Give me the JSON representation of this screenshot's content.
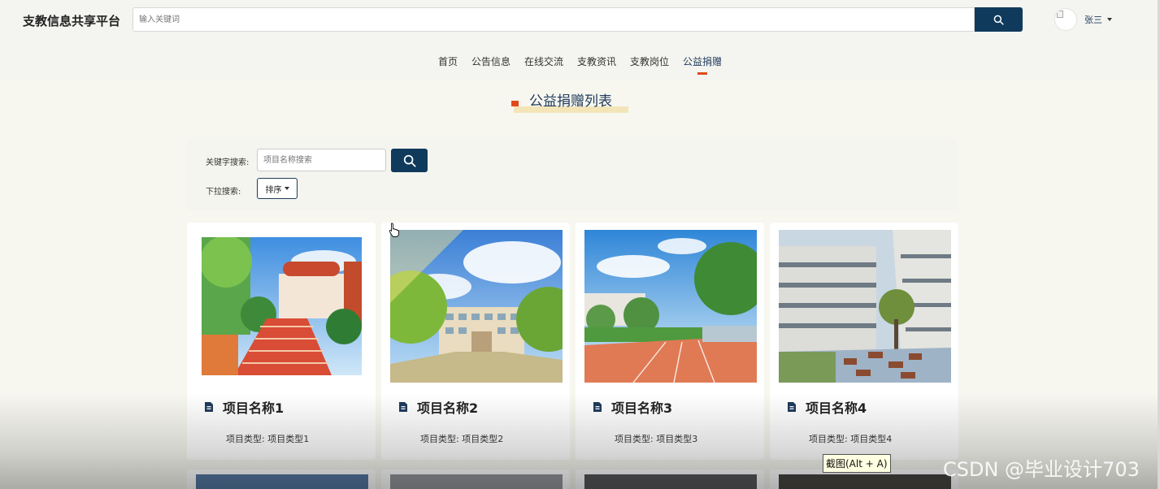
{
  "header": {
    "brand": "支教信息共享平台",
    "search_placeholder": "输入关键词",
    "username": "张三"
  },
  "nav": [
    {
      "label": "首页",
      "active": false
    },
    {
      "label": "公告信息",
      "active": false
    },
    {
      "label": "在线交流",
      "active": false
    },
    {
      "label": "支教资讯",
      "active": false
    },
    {
      "label": "支教岗位",
      "active": false
    },
    {
      "label": "公益捐赠",
      "active": true
    }
  ],
  "page_title": "公益捐赠列表",
  "filter": {
    "keyword_label": "关键字搜索:",
    "keyword_placeholder": "项目名称搜索",
    "dropdown_label": "下拉搜索:",
    "sort_label": "排序"
  },
  "items": [
    {
      "name": "项目名称1",
      "type_label": "项目类型:",
      "type_value": "项目类型1"
    },
    {
      "name": "项目名称2",
      "type_label": "项目类型:",
      "type_value": "项目类型2"
    },
    {
      "name": "项目名称3",
      "type_label": "项目类型:",
      "type_value": "项目类型3"
    },
    {
      "name": "项目名称4",
      "type_label": "项目类型:",
      "type_value": "项目类型4"
    }
  ],
  "tooltip": "截图(Alt + A)",
  "watermark": "CSDN @毕业设计703",
  "colors": {
    "primary": "#0f3a5c",
    "accent": "#e04a1c",
    "title": "#1f3a5a"
  }
}
